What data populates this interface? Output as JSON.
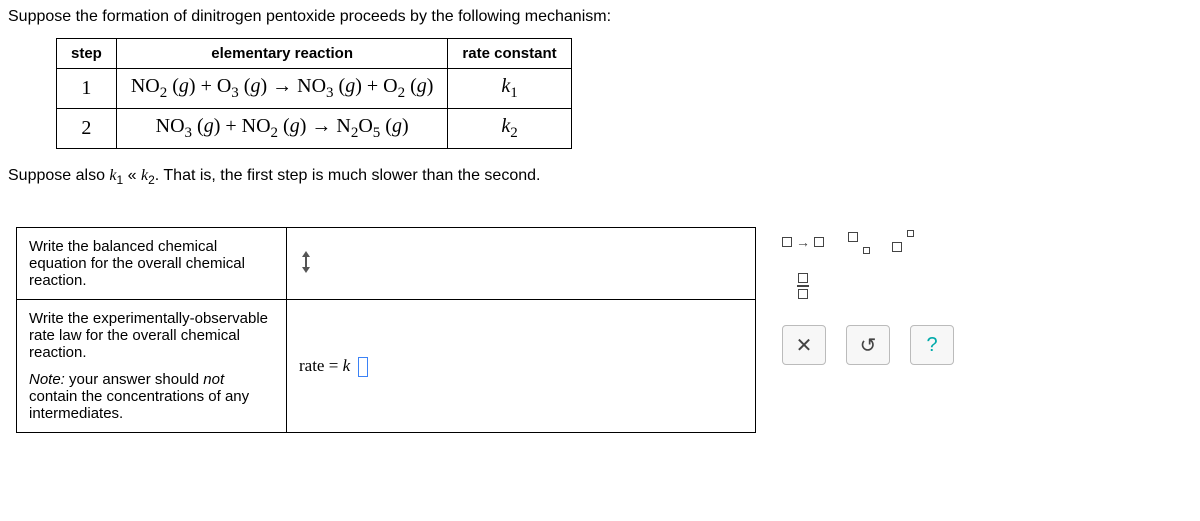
{
  "intro": "Suppose the formation of dinitrogen pentoxide proceeds by the following mechanism:",
  "mech_table": {
    "headers": {
      "step": "step",
      "reaction": "elementary reaction",
      "rateconst": "rate constant"
    },
    "rows": [
      {
        "step": "1",
        "reaction_html": "NO<sub>2</sub> (<span class='italic'>g</span>) + O<sub>3</sub> (<span class='italic'>g</span>) → NO<sub>3</sub> (<span class='italic'>g</span>) + O<sub>2</sub> (<span class='italic'>g</span>)",
        "rateconst_html": "<span class='italic'>k</span><sub>1</sub>"
      },
      {
        "step": "2",
        "reaction_html": "NO<sub>3</sub> (<span class='italic'>g</span>) + NO<sub>2</sub> (<span class='italic'>g</span>) → N<sub>2</sub>O<sub>5</sub> (<span class='italic'>g</span>)",
        "rateconst_html": "<span class='italic'>k</span><sub>2</sub>"
      }
    ]
  },
  "suppose2_html": "Suppose also <span class='serif italic'>k</span><sub>1</sub> « <span class='serif italic'>k</span><sub>2</sub>. That is, the first step is much slower than the second.",
  "answers": {
    "row1": {
      "prompt": "Write the balanced chemical equation for the overall chemical reaction."
    },
    "row2": {
      "prompt_main": "Write the experimentally-observable rate law for the overall chemical reaction.",
      "prompt_note_html": "<span class='italic'>Note:</span> your answer should <span class='italic'>not</span> contain the concentrations of any intermediates.",
      "rate_label_html": "rate = <span class='italic'>k</span>"
    }
  },
  "toolbar": {
    "yields_name": "yields-arrow",
    "subscript_name": "subscript",
    "superscript_name": "superscript",
    "fraction_name": "fraction",
    "clear_label": "✕",
    "reset_label": "↺",
    "help_label": "?"
  }
}
